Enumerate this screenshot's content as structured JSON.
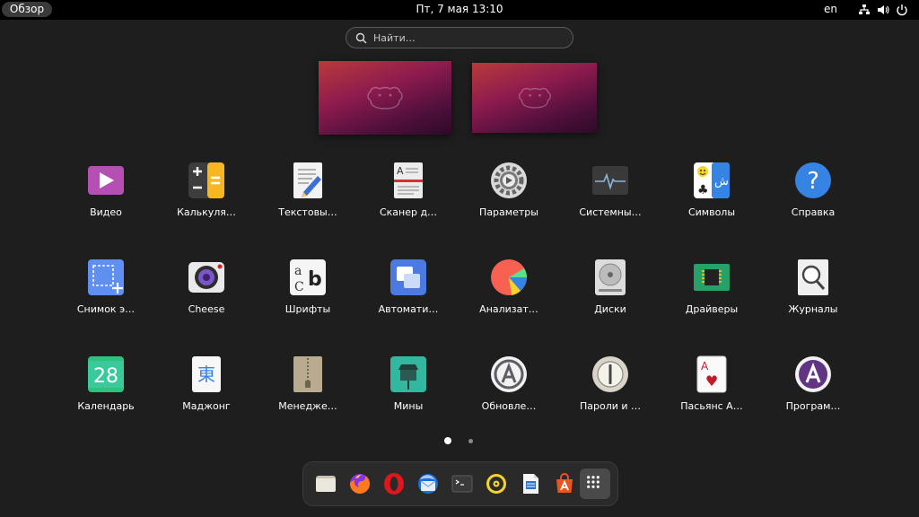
{
  "topbar": {
    "activities_label": "Обзор",
    "clock": "Пт, 7 мая  13:10",
    "keyboard_layout": "en"
  },
  "search": {
    "placeholder": "Найти…"
  },
  "apps": [
    {
      "label": "Видео",
      "icon": "video-icon"
    },
    {
      "label": "Калькуля…",
      "icon": "calculator-icon"
    },
    {
      "label": "Текстовы…",
      "icon": "text-editor-icon"
    },
    {
      "label": "Сканер д…",
      "icon": "document-scanner-icon"
    },
    {
      "label": "Параметры",
      "icon": "settings-gear-icon"
    },
    {
      "label": "Системны…",
      "icon": "system-monitor-icon"
    },
    {
      "label": "Символы",
      "icon": "characters-icon"
    },
    {
      "label": "Справка",
      "icon": "help-icon"
    },
    {
      "label": "Снимок э…",
      "icon": "screenshot-icon"
    },
    {
      "label": "Cheese",
      "icon": "cheese-webcam-icon"
    },
    {
      "label": "Шрифты",
      "icon": "fonts-icon"
    },
    {
      "label": "Автомати…",
      "icon": "startup-apps-icon"
    },
    {
      "label": "Анализат…",
      "icon": "disk-usage-analyzer-icon"
    },
    {
      "label": "Диски",
      "icon": "disks-icon"
    },
    {
      "label": "Драйверы",
      "icon": "drivers-chip-icon"
    },
    {
      "label": "Журналы",
      "icon": "logs-icon"
    },
    {
      "label": "Календарь",
      "icon": "calendar-icon"
    },
    {
      "label": "Маджонг",
      "icon": "mahjongg-icon"
    },
    {
      "label": "Менедже…",
      "icon": "archive-manager-icon"
    },
    {
      "label": "Мины",
      "icon": "mines-icon"
    },
    {
      "label": "Обновле…",
      "icon": "software-updater-icon"
    },
    {
      "label": "Пароли и …",
      "icon": "passwords-keys-icon"
    },
    {
      "label": "Пасьянс А…",
      "icon": "solitaire-cards-icon"
    },
    {
      "label": "Програм…",
      "icon": "software-properties-icon"
    }
  ],
  "calendar_day": "28",
  "mahjongg_glyph": "東",
  "dock": [
    {
      "name": "files-icon"
    },
    {
      "name": "firefox-icon"
    },
    {
      "name": "opera-icon"
    },
    {
      "name": "thunderbird-icon"
    },
    {
      "name": "terminal-icon"
    },
    {
      "name": "rhythmbox-icon"
    },
    {
      "name": "libreoffice-writer-icon"
    },
    {
      "name": "ubuntu-software-icon"
    },
    {
      "name": "show-applications-icon"
    }
  ],
  "colors": {
    "background": "#1e1e1e",
    "topbar": "#000000",
    "dock": "#2a2a2a",
    "wallpaper_top": "#b93a3a",
    "wallpaper_bottom": "#2e0a26"
  }
}
